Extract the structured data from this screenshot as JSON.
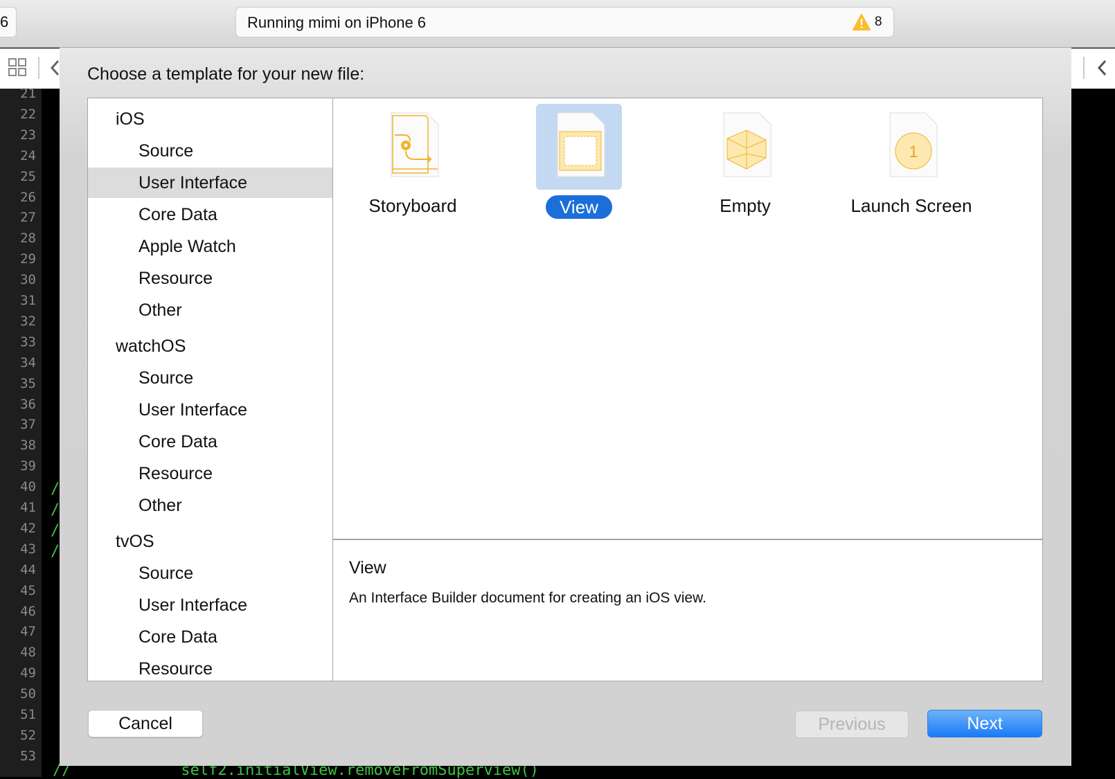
{
  "toolbar": {
    "scheme_fragment": "6",
    "activity_text": "Running mimi on iPhone 6",
    "warning_count": "8",
    "warning_color": "#fbbd2c"
  },
  "editor": {
    "line_numbers": [
      "21",
      "22",
      "23",
      "24",
      "25",
      "26",
      "27",
      "28",
      "29",
      "30",
      "31",
      "32",
      "33",
      "34",
      "35",
      "36",
      "37",
      "38",
      "39",
      "40",
      "41",
      "42",
      "43",
      "44",
      "45",
      "46",
      "47",
      "48",
      "49",
      "50",
      "51",
      "52",
      "53"
    ],
    "comment_marks": [
      "/",
      "/",
      "/",
      "/"
    ],
    "bottom_code": "//            self2.initialView.removeFromSuperview()"
  },
  "dialog": {
    "title": "Choose a template for your new file:",
    "categories": [
      {
        "label": "iOS",
        "type": "header"
      },
      {
        "label": "Source",
        "type": "item"
      },
      {
        "label": "User Interface",
        "type": "item",
        "selected": true
      },
      {
        "label": "Core Data",
        "type": "item"
      },
      {
        "label": "Apple Watch",
        "type": "item"
      },
      {
        "label": "Resource",
        "type": "item"
      },
      {
        "label": "Other",
        "type": "item"
      },
      {
        "label": "watchOS",
        "type": "header"
      },
      {
        "label": "Source",
        "type": "item"
      },
      {
        "label": "User Interface",
        "type": "item"
      },
      {
        "label": "Core Data",
        "type": "item"
      },
      {
        "label": "Resource",
        "type": "item"
      },
      {
        "label": "Other",
        "type": "item"
      },
      {
        "label": "tvOS",
        "type": "header"
      },
      {
        "label": "Source",
        "type": "item"
      },
      {
        "label": "User Interface",
        "type": "item"
      },
      {
        "label": "Core Data",
        "type": "item"
      },
      {
        "label": "Resource",
        "type": "item"
      }
    ],
    "templates": [
      {
        "label": "Storyboard",
        "icon": "storyboard-file-icon"
      },
      {
        "label": "View",
        "icon": "view-file-icon",
        "selected": true
      },
      {
        "label": "Empty",
        "icon": "empty-file-icon"
      },
      {
        "label": "Launch Screen",
        "icon": "launch-screen-file-icon",
        "badge": "1"
      }
    ],
    "description": {
      "name": "View",
      "text": "An Interface Builder document for creating an iOS view."
    },
    "buttons": {
      "cancel": "Cancel",
      "previous": "Previous",
      "next": "Next"
    }
  }
}
